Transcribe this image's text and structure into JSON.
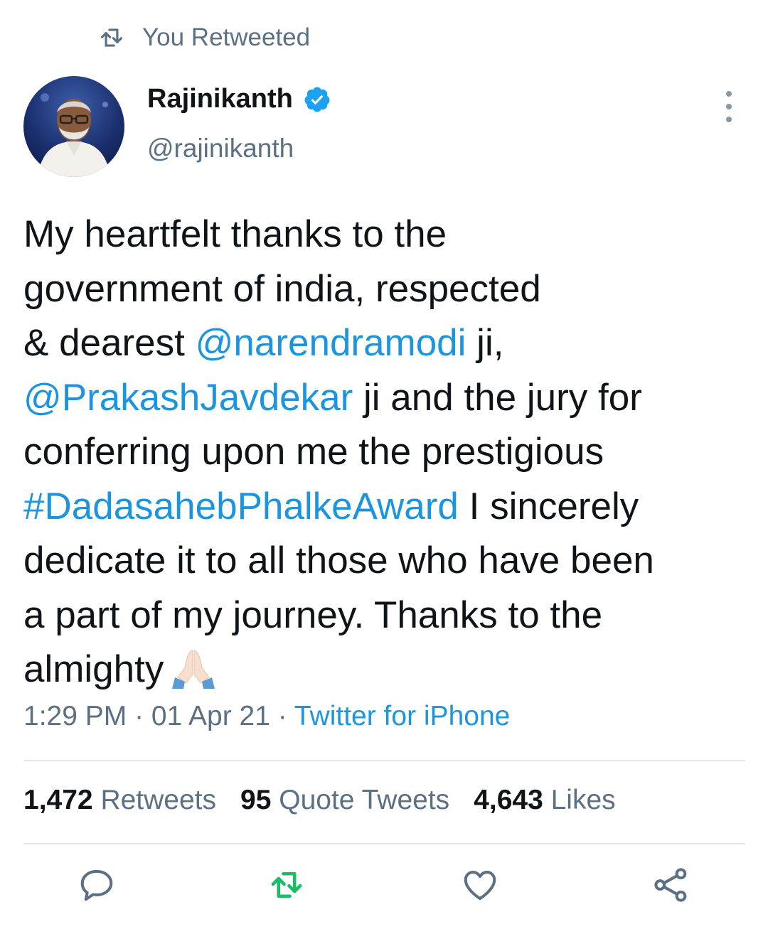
{
  "retweet_header": {
    "icon": "retweet-icon",
    "label": "You Retweeted"
  },
  "author": {
    "name": "Rajinikanth",
    "handle": "@rajinikanth",
    "verified_icon": "verified-badge-icon",
    "avatar_icon": "profile-avatar"
  },
  "tweet": {
    "t1": "My heartfelt thanks to the\ngovernment of india, respected\n& dearest ",
    "mention1": "@narendramodi",
    "t2": " ji,\n",
    "mention2": "@PrakashJavdekar",
    "t3": " ji and the jury for\nconferring upon me the prestigious\n",
    "hashtag": "#DadasahebPhalkeAward",
    "t4": " I sincerely\ndedicate it to all those who have been\na part of my journey. Thanks to the\nalmighty",
    "emoji": "folded-hands-emoji"
  },
  "meta": {
    "time": "1:29 PM",
    "sep1": " · ",
    "date": "01 Apr 21",
    "sep2": " · ",
    "source": "Twitter for iPhone"
  },
  "stats": {
    "retweets_count": "1,472",
    "retweets_label": " Retweets",
    "quotes_count": "95",
    "quotes_label": " Quote Tweets",
    "likes_count": "4,643",
    "likes_label": " Likes"
  },
  "actions": {
    "reply_icon": "reply-icon",
    "retweet_icon": "retweet-icon",
    "like_icon": "heart-icon",
    "share_icon": "share-icon",
    "retweet_active_color": "#17bf63",
    "icon_color": "#5b7083"
  },
  "colors": {
    "link": "#1b95e0",
    "secondary_text": "#5b7083",
    "primary_text": "#0f1419",
    "verified": "#1da1f2"
  }
}
